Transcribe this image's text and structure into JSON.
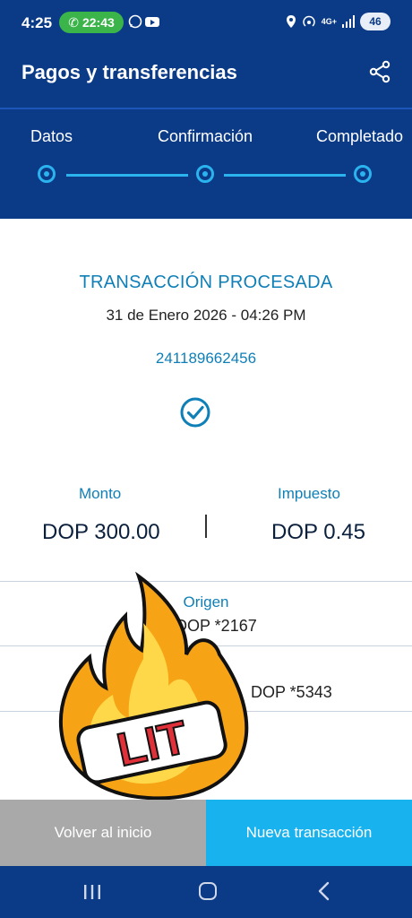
{
  "status_bar": {
    "time": "4:25",
    "call_timer": "22:43",
    "battery": "46",
    "network": "4G+"
  },
  "header": {
    "title": "Pagos y transferencias",
    "share_icon": "share-icon"
  },
  "stepper": {
    "steps": [
      {
        "label": "Datos"
      },
      {
        "label": "Confirmación"
      },
      {
        "label": "Completado"
      }
    ]
  },
  "transaction": {
    "status": "TRANSACCIÓN PROCESADA",
    "date": "31 de Enero 2026 - 04:26 PM",
    "reference": "241189662456",
    "amount_label": "Monto",
    "amount": "DOP 300.00",
    "tax_label": "Impuesto",
    "tax": "DOP 0.45",
    "origin_label": "Origen",
    "origin_value": "DOP *2167",
    "destination_value": "DOP *5343"
  },
  "sticker": {
    "text": "LIT"
  },
  "actions": {
    "home_button": "Volver al inicio",
    "new_button": "Nueva transacción"
  },
  "colors": {
    "primary": "#0b3a86",
    "accent": "#18b2ef",
    "link": "#0f7fb7"
  }
}
